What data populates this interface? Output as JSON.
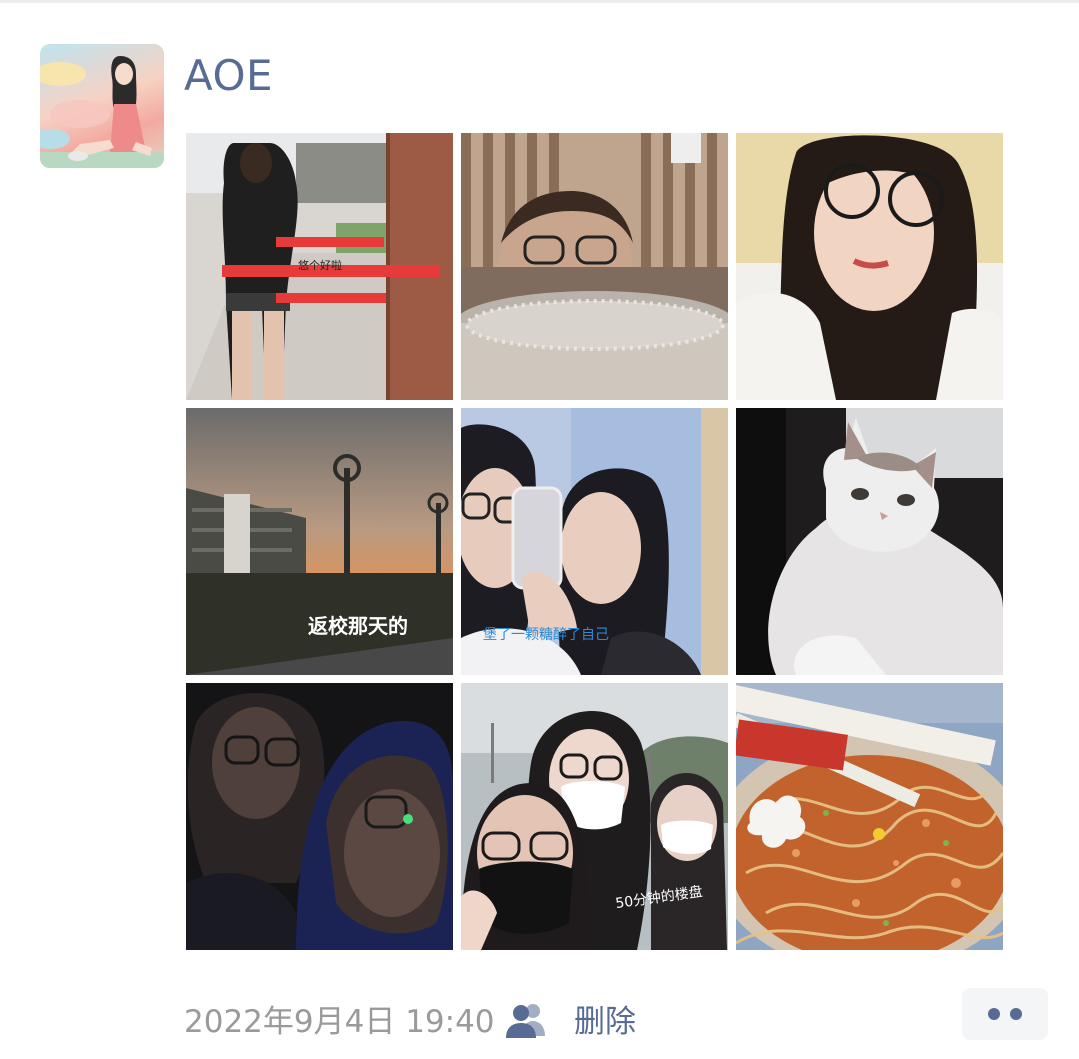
{
  "post": {
    "username": "AOE",
    "timestamp": "2022年9月4日 19:40",
    "delete_label": "删除",
    "visibility_icon": "people-icon",
    "more_icon": "more-dots-icon"
  },
  "photos": [
    {
      "caption": "悠个好啦"
    },
    {
      "caption": ""
    },
    {
      "caption": ""
    },
    {
      "caption": "返校那天的"
    },
    {
      "caption": "堡了一颗糖醉了自己"
    },
    {
      "caption": ""
    },
    {
      "caption": ""
    },
    {
      "caption": "50分钟的楼盘"
    },
    {
      "caption": ""
    }
  ],
  "colors": {
    "link": "#576b95",
    "meta": "#9a9a9a",
    "more_bg": "#f4f5f7"
  }
}
